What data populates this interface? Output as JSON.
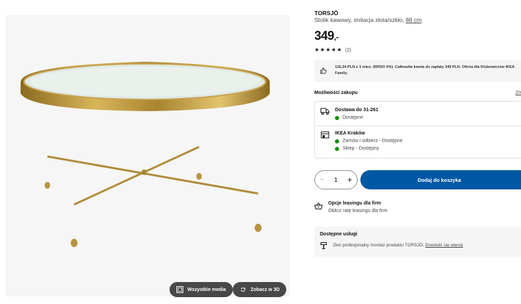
{
  "product": {
    "name": "TORSJÖ",
    "description": "Stolik kawowy, imitacja złota/szkło,",
    "size_link": "88 cm",
    "price": "349",
    "price_suffix": ",-",
    "rating_stars": 5,
    "review_count": "(2)"
  },
  "finance": {
    "text": "116,34 PLN x 3 mies. (RRSO 0%). Całkowita kwota do zapłaty 349 PLN. Oferta dla Klubowiczów IKEA Family."
  },
  "purchase": {
    "label": "Możliwości zakupu",
    "more_link": "Zm",
    "delivery_title": "Dostawa do 31-261",
    "delivery_status": "Dostępne",
    "store_title": "IKEA Kraków",
    "store_status_1": "Zamów i odbierz - Dostępne",
    "store_status_2": "Sklep - Dostępny",
    "status_color": "#0a8a00"
  },
  "cart": {
    "quantity": "1",
    "minus_symbol": "−",
    "plus_symbol": "+",
    "add_label": "Dodaj do koszyka",
    "accent": "#0058a3"
  },
  "leasing": {
    "title": "Opcje leasingu dla firm",
    "subtitle": "Oblicz ratę leasingu dla firm"
  },
  "services": {
    "title": "Dostępne usługi",
    "text": "Zleć profesjonalny montaż produktu TORSJÖ.",
    "link": "Dowiedz się więcej"
  },
  "media": {
    "all_media_label": "Wszystkie media",
    "view_3d_label": "Zobacz w 3D",
    "button_color": "#484848"
  }
}
